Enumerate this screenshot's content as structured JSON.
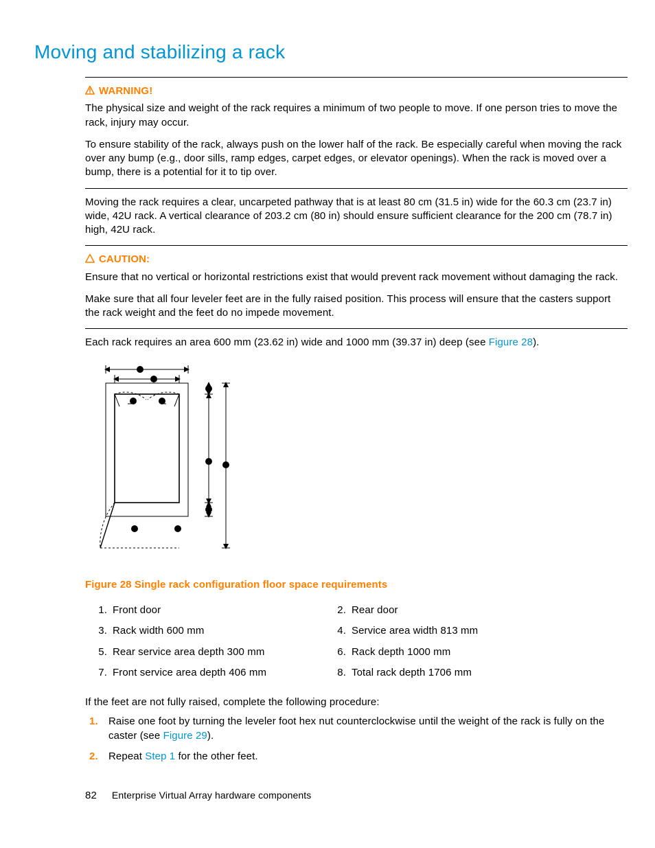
{
  "heading": "Moving and stabilizing a rack",
  "warning": {
    "label": "WARNING!",
    "p1": "The physical size and weight of the rack requires a minimum of two people to move. If one person tries to move the rack, injury may occur.",
    "p2": "To ensure stability of the rack, always push on the lower half of the rack. Be especially careful when moving the rack over any bump (e.g., door sills, ramp edges, carpet edges, or elevator openings). When the rack is moved over a bump, there is a potential for it to tip over."
  },
  "clearance_p": "Moving the rack requires a clear, uncarpeted pathway that is at least 80 cm (31.5 in) wide for the 60.3 cm (23.7 in) wide, 42U rack. A vertical clearance of 203.2 cm (80 in) should ensure sufficient clearance for the 200 cm (78.7 in) high, 42U rack.",
  "caution": {
    "label": "CAUTION:",
    "p1": "Ensure that no vertical or horizontal restrictions exist that would prevent rack movement without damaging the rack.",
    "p2": "Make sure that all four leveler feet are in the fully raised position. This process will ensure that the casters support the rack weight and the feet do no impede movement."
  },
  "area_prefix": "Each rack requires an area 600 mm (23.62 in) wide and 1000 mm (39.37 in) deep (see ",
  "area_link": "Figure 28",
  "area_suffix": ").",
  "figure_caption": "Figure 28 Single rack configuration floor space requirements",
  "legend": [
    {
      "n": "1.",
      "t": "Front door"
    },
    {
      "n": "2.",
      "t": "Rear door"
    },
    {
      "n": "3.",
      "t": "Rack width 600 mm"
    },
    {
      "n": "4.",
      "t": "Service area width 813 mm"
    },
    {
      "n": "5.",
      "t": "Rear service area depth 300 mm"
    },
    {
      "n": "6.",
      "t": "Rack depth 1000 mm"
    },
    {
      "n": "7.",
      "t": "Front service area depth 406 mm"
    },
    {
      "n": "8.",
      "t": "Total rack depth 1706 mm"
    }
  ],
  "procedure_intro": "If the feet are not fully raised, complete the following procedure:",
  "steps": {
    "s1_num": "1.",
    "s1a": "Raise one foot by turning the leveler foot hex nut counterclockwise until the weight of the rack is fully on the caster (see ",
    "s1_link": "Figure 29",
    "s1b": ").",
    "s2_num": "2.",
    "s2a": "Repeat ",
    "s2_link": "Step 1",
    "s2b": " for the other feet."
  },
  "footer": {
    "page": "82",
    "title": "Enterprise Virtual Array hardware components"
  }
}
